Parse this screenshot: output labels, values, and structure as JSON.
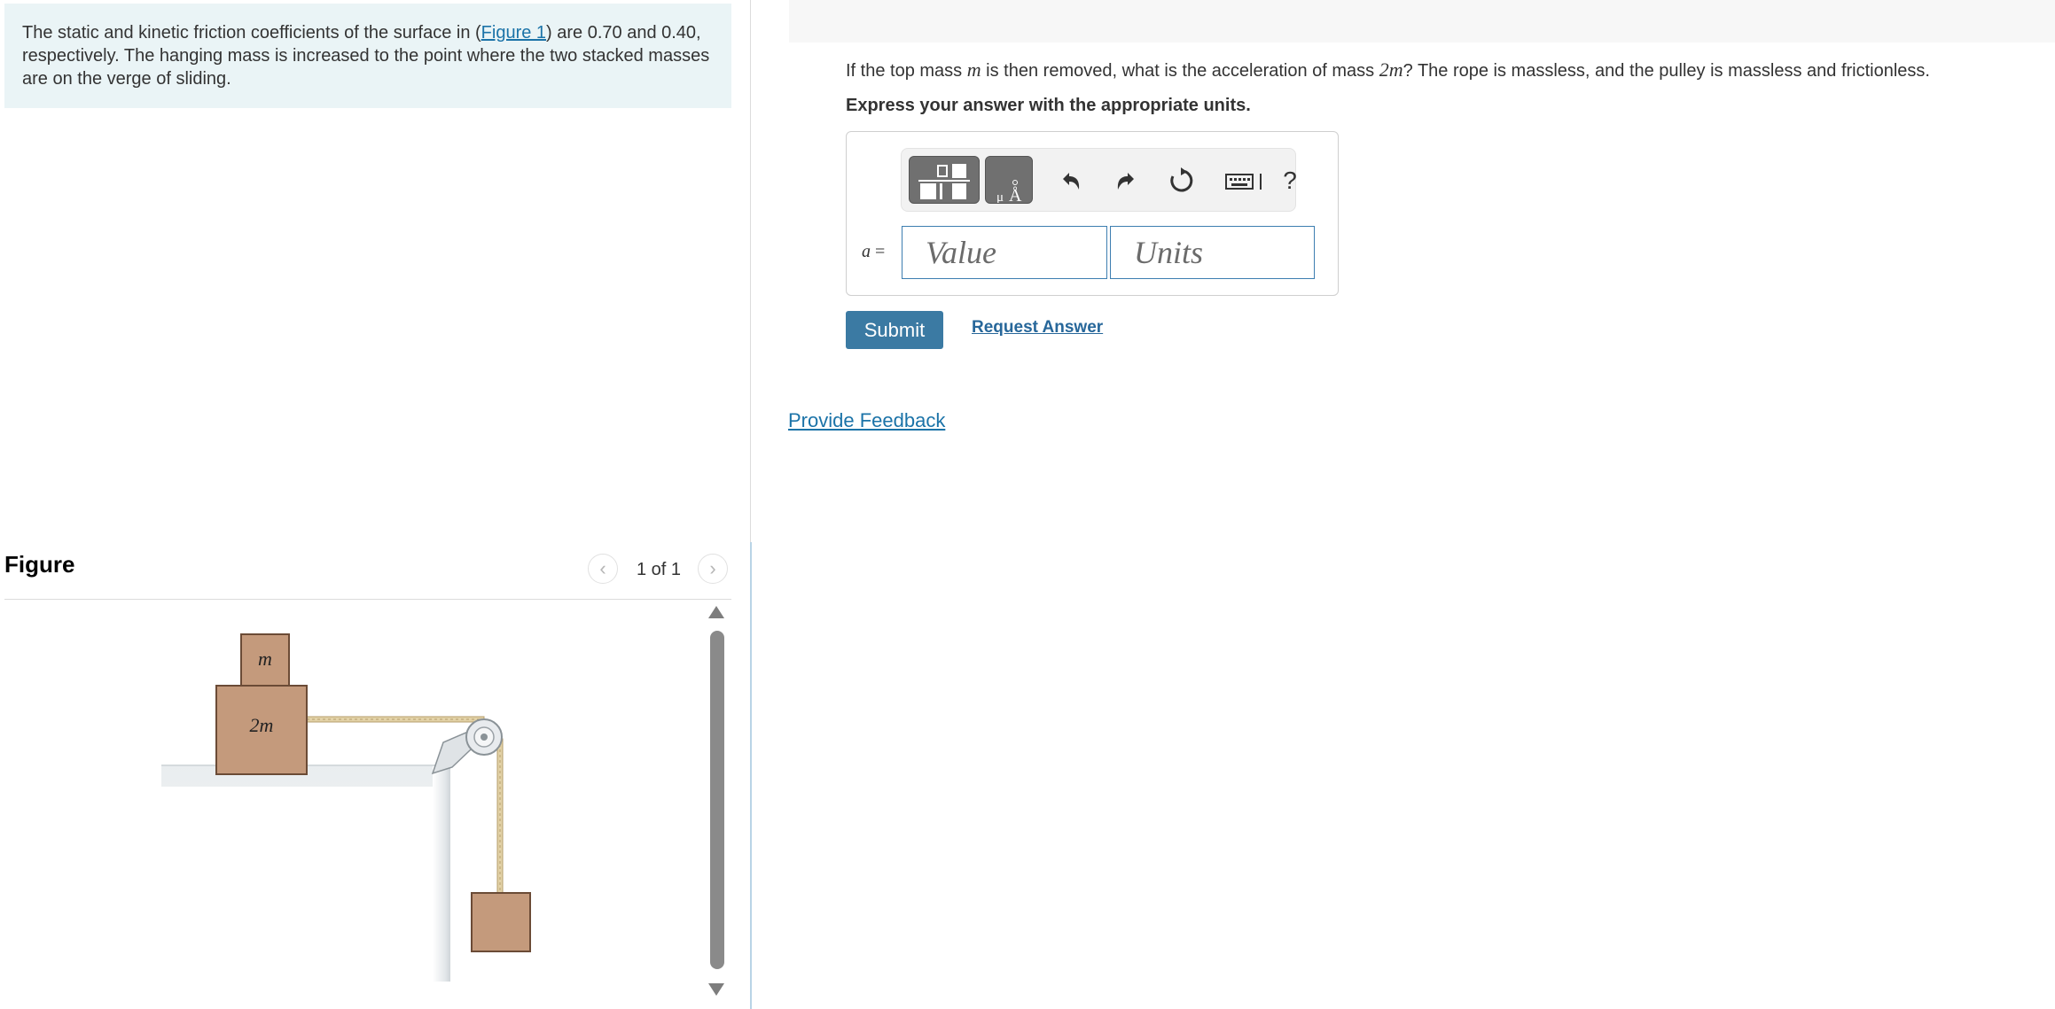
{
  "intro": {
    "text_before_link": "The static and kinetic friction coefficients of the surface in (",
    "figure_link": "Figure 1",
    "text_after_link": ") are 0.70 and 0.40, respectively. The hanging mass is increased to the point where the two stacked masses are on the verge of sliding."
  },
  "figure": {
    "title": "Figure",
    "counter": "1 of 1",
    "top_block_label": "m",
    "bottom_block_label": "2m"
  },
  "question": {
    "text_1": "If the top mass ",
    "math_m": "m",
    "text_2": " is then removed, what is the acceleration of mass ",
    "math_2m": "2m",
    "text_3": "? The rope is massless, and the pulley is massless and frictionless.",
    "instruction": "Express your answer with the appropriate units."
  },
  "answer": {
    "variable": "a",
    "equals": " =",
    "value_placeholder": "Value",
    "units_placeholder": "Units",
    "help": "?"
  },
  "actions": {
    "submit": "Submit",
    "request_answer": "Request Answer",
    "provide_feedback": "Provide Feedback"
  },
  "icons": {
    "template": "template-icon",
    "units": "units-icon",
    "undo": "undo-icon",
    "redo": "redo-icon",
    "reset": "reset-icon",
    "keyboard": "keyboard-icon",
    "prev": "chevron-left-icon",
    "next": "chevron-right-icon"
  },
  "colors": {
    "intro_bg": "#eaf4f6",
    "link": "#1b73a8",
    "submit_bg": "#3b7aa3",
    "input_border": "#3d7eb0",
    "block_fill": "#c49a7c"
  }
}
